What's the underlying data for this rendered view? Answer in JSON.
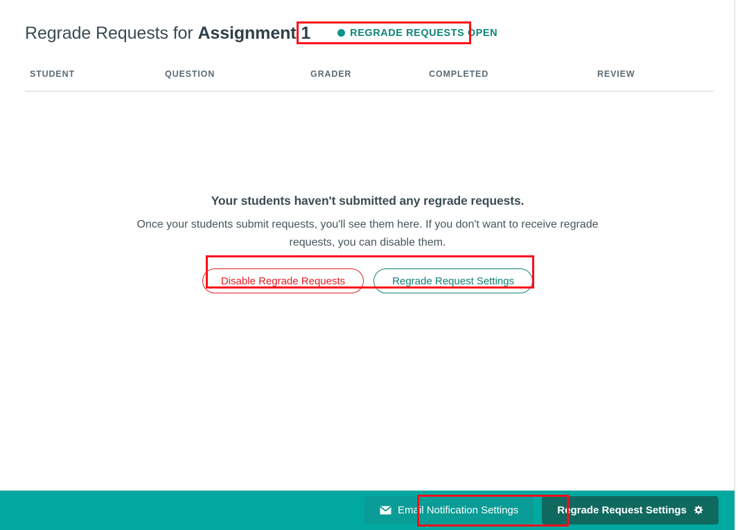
{
  "header": {
    "title_prefix": "Regrade Requests for ",
    "assignment_name": "Assignment 1",
    "status_badge": {
      "label": "Regrade Requests Open",
      "dot_icon": "status-dot-icon",
      "color": "#0d8578"
    }
  },
  "table": {
    "columns": [
      {
        "key": "student",
        "label": "Student"
      },
      {
        "key": "question",
        "label": "Question"
      },
      {
        "key": "grader",
        "label": "Grader"
      },
      {
        "key": "completed",
        "label": "Completed"
      },
      {
        "key": "review",
        "label": "Review"
      }
    ],
    "rows": []
  },
  "empty_state": {
    "title": "Your students haven't submitted any regrade requests.",
    "description": "Once your students submit requests, you'll see them here. If you don't want to receive regrade requests, you can disable them.",
    "actions": {
      "disable_label": "Disable Regrade Requests",
      "settings_label": "Regrade Request Settings"
    }
  },
  "footer": {
    "email_button": {
      "label": "Email Notification Settings",
      "icon": "envelope-icon"
    },
    "settings_button": {
      "label": "Regrade Request Settings",
      "icon": "gear-icon"
    }
  },
  "colors": {
    "footer_bar": "#00a8a0",
    "footer_settings_button": "#10695f",
    "footer_email_button": "#0a9c96",
    "teal_accent": "#0e8174",
    "danger": "#e01d25",
    "annotation": "#fc0d1b",
    "text_primary": "#3a4b52",
    "table_header_text": "#5b6b75",
    "divider": "#e3e5eb"
  }
}
